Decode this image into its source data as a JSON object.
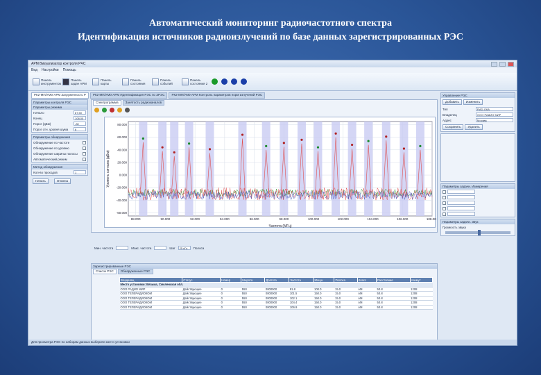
{
  "slide": {
    "title_line1": "Автоматический мониторинг радиочастотного спектра",
    "title_line2": "Идентификация источников радиоизлучений по базе данных зарегистрированных РЭС"
  },
  "window": {
    "title": "АРМ Визуализатор контроля РЧС",
    "menu": [
      "Вид",
      "Настройки",
      "Помощь"
    ]
  },
  "ribbon": {
    "groups": [
      "Панель инструментов",
      "Панель задач АРМ",
      "Панель карты",
      "Панель состояния",
      "Панель событий",
      "Панель состояния 2"
    ],
    "dot_colors": [
      "#1a9a2a",
      "#1b3fa8",
      "#1b3fa8",
      "#1b3fa8"
    ]
  },
  "doc_tabs": [
    "РК2-МП/УМ0-АРМ Загруженность Р",
    "РК2-МП/УМ0-АРМ Идентификация РЭС по ЗРЭС",
    "РК2-МП/УМ0-АРМ Контроль параметров норм излучений РЭС"
  ],
  "left": {
    "panel_title": "Параметры контроля РЭС",
    "sections": [
      "Параметры режима",
      "Параметры обнаружения",
      "Метод обнаружения"
    ],
    "rows": [
      {
        "label": "Начало",
        "value": "87.50"
      },
      {
        "label": "Конец",
        "value": "108.00"
      },
      {
        "label": "Порог (дБм)",
        "value": "-80"
      },
      {
        "label": "Порог отн. уровня шума",
        "value": "6"
      },
      {
        "label": "Кол-во проходов",
        "value": "1"
      }
    ],
    "checks": [
      "Обнаружение по частоте",
      "Обнаружение по уровню",
      "Обнаружение ширины полосы",
      "Автоматический режим"
    ],
    "buttons": [
      "Начать",
      "Отмена"
    ]
  },
  "center": {
    "tabs": [
      "Спектрограмма",
      "Занятость радиоканалов"
    ],
    "chart_title": "",
    "xlabel": "Частота (МГц)",
    "ylabel": "Уровень сигнала (дБм)",
    "footer": [
      "Мин. частота",
      "Макс. частота",
      "Шаг",
      "Полоса",
      "25 кГц"
    ]
  },
  "chart_data": {
    "type": "line",
    "x_ticks": [
      "88.000",
      "90.000",
      "92.000",
      "94.000",
      "96.000",
      "98.000",
      "100.000",
      "102.000",
      "104.000",
      "106.000",
      "108.000"
    ],
    "y_ticks": [
      "80.000",
      "60.000",
      "40.000",
      "20.000",
      "0.000",
      "-20.000",
      "-40.000",
      "-60.000"
    ],
    "ylim": [
      -65,
      85
    ],
    "xlim": [
      87.5,
      108
    ],
    "grid": true
  },
  "bottom": {
    "panel_title": "Зарегистрированные РЭС",
    "tabs": [
      "Список РЭС",
      "Обнаруженные РЭС"
    ],
    "columns": [
      "Владелец",
      "Статус",
      "Номер",
      "Широта",
      "Долгота",
      "Частота",
      "Мощн.",
      "Полоса",
      "Класс",
      "Расстояние",
      "Азимут"
    ],
    "group_row": "Место установки: Вязьма, Смоленская обл.",
    "rows": [
      [
        "ООО РАДИО МИР",
        "Действующее",
        "0",
        "550",
        "0000000",
        "91.8",
        "100.0",
        "15.0",
        "AM",
        "50.8",
        "1208"
      ],
      [
        "ООО ТЕЛЕРАДИОКОМ",
        "Действующее",
        "0",
        "550",
        "0000000",
        "101.5",
        "150.0",
        "15.0",
        "AM",
        "50.8",
        "1208"
      ],
      [
        "ООО ТЕЛЕРАДИОКОМ",
        "Действующее",
        "0",
        "550",
        "0000000",
        "102.1",
        "150.0",
        "15.0",
        "AM",
        "50.8",
        "1208"
      ],
      [
        "ООО ТЕЛЕРАДИОКОМ",
        "Действующее",
        "0",
        "550",
        "0000000",
        "104.4",
        "150.0",
        "15.0",
        "AM",
        "50.8",
        "1208"
      ],
      [
        "ООО ТЕЛЕРАДИОКОМ",
        "Действующее",
        "0",
        "550",
        "0000000",
        "106.9",
        "150.0",
        "15.0",
        "AM",
        "50.8",
        "1208"
      ]
    ]
  },
  "right": {
    "panel_title": "Управление РЭС",
    "fields": [
      {
        "label": "Тип",
        "value": "RAD-ОКА"
      },
      {
        "label": "Владелец",
        "value": "ООО РАДИО МИР"
      },
      {
        "label": "Адрес",
        "value": "Москва"
      }
    ],
    "buttons": [
      "Добавить",
      "Изменить",
      "Удалить",
      "Сохранить"
    ],
    "section2": "Параметры задачи. Измерения",
    "section3": "Параметры задачи. Звук",
    "volume_label": "Громкость звука"
  },
  "status_bar": "Для просмотра РЭС по наборам данных выберите место установки"
}
